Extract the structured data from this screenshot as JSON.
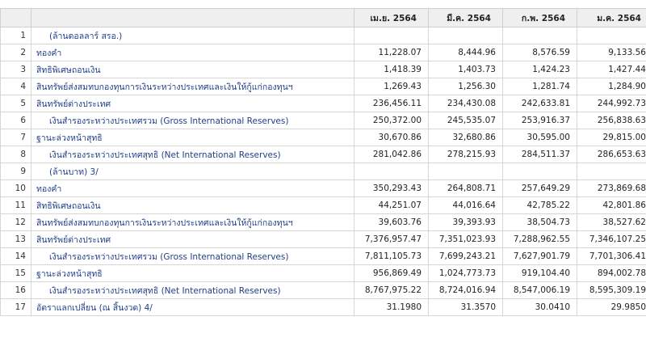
{
  "table": {
    "columns": [
      "เม.ย. 2564",
      "มี.ค. 2564",
      "ก.พ. 2564",
      "ม.ค. 2564"
    ],
    "rows": [
      {
        "num": "1",
        "label": "(ล้านดอลลาร์ สรอ.)",
        "indent": true,
        "values": [
          "",
          "",
          "",
          ""
        ]
      },
      {
        "num": "2",
        "label": "ทองคำ",
        "indent": false,
        "values": [
          "11,228.07",
          "8,444.96",
          "8,576.59",
          "9,133.56"
        ]
      },
      {
        "num": "3",
        "label": "สิทธิพิเศษถอนเงิน",
        "indent": false,
        "values": [
          "1,418.39",
          "1,403.73",
          "1,424.23",
          "1,427.44"
        ]
      },
      {
        "num": "4",
        "label": "สินทรัพย์ส่งสมทบกองทุนการเงินระหว่างประเทศและเงินให้กู้แก่กองทุนฯ",
        "indent": false,
        "values": [
          "1,269.43",
          "1,256.30",
          "1,281.74",
          "1,284.90"
        ]
      },
      {
        "num": "5",
        "label": "สินทรัพย์ต่างประเทศ",
        "indent": false,
        "values": [
          "236,456.11",
          "234,430.08",
          "242,633.81",
          "244,992.73"
        ]
      },
      {
        "num": "6",
        "label": "เงินสำรองระหว่างประเทศรวม (Gross International Reserves)",
        "indent": true,
        "values": [
          "250,372.00",
          "245,535.07",
          "253,916.37",
          "256,838.63"
        ]
      },
      {
        "num": "7",
        "label": "ฐานะล่วงหน้าสุทธิ",
        "indent": false,
        "values": [
          "30,670.86",
          "32,680.86",
          "30,595.00",
          "29,815.00"
        ]
      },
      {
        "num": "8",
        "label": "เงินสำรองระหว่างประเทศสุทธิ (Net International Reserves)",
        "indent": true,
        "values": [
          "281,042.86",
          "278,215.93",
          "284,511.37",
          "286,653.63"
        ]
      },
      {
        "num": "9",
        "label": "(ล้านบาท) 3/",
        "indent": true,
        "values": [
          "",
          "",
          "",
          ""
        ]
      },
      {
        "num": "10",
        "label": "ทองคำ",
        "indent": false,
        "values": [
          "350,293.43",
          "264,808.71",
          "257,649.29",
          "273,869.68"
        ]
      },
      {
        "num": "11",
        "label": "สิทธิพิเศษถอนเงิน",
        "indent": false,
        "values": [
          "44,251.07",
          "44,016.64",
          "42,785.22",
          "42,801.86"
        ]
      },
      {
        "num": "12",
        "label": "สินทรัพย์ส่งสมทบกองทุนการเงินระหว่างประเทศและเงินให้กู้แก่กองทุนฯ",
        "indent": false,
        "values": [
          "39,603.76",
          "39,393.93",
          "38,504.73",
          "38,527.62"
        ]
      },
      {
        "num": "13",
        "label": "สินทรัพย์ต่างประเทศ",
        "indent": false,
        "values": [
          "7,376,957.47",
          "7,351,023.93",
          "7,288,962.55",
          "7,346,107.25"
        ]
      },
      {
        "num": "14",
        "label": "เงินสำรองระหว่างประเทศรวม (Gross International Reserves)",
        "indent": true,
        "values": [
          "7,811,105.73",
          "7,699,243.21",
          "7,627,901.79",
          "7,701,306.41"
        ]
      },
      {
        "num": "15",
        "label": "ฐานะล่วงหน้าสุทธิ",
        "indent": false,
        "values": [
          "956,869.49",
          "1,024,773.73",
          "919,104.40",
          "894,002.78"
        ]
      },
      {
        "num": "16",
        "label": "เงินสำรองระหว่างประเทศสุทธิ (Net International Reserves)",
        "indent": true,
        "values": [
          "8,767,975.22",
          "8,724,016.94",
          "8,547,006.19",
          "8,595,309.19"
        ]
      },
      {
        "num": "17",
        "label": "อัตราแลกเปลี่ยน (ณ สิ้นงวด) 4/",
        "indent": false,
        "values": [
          "31.1980",
          "31.3570",
          "30.0410",
          "29.9850"
        ]
      }
    ]
  }
}
